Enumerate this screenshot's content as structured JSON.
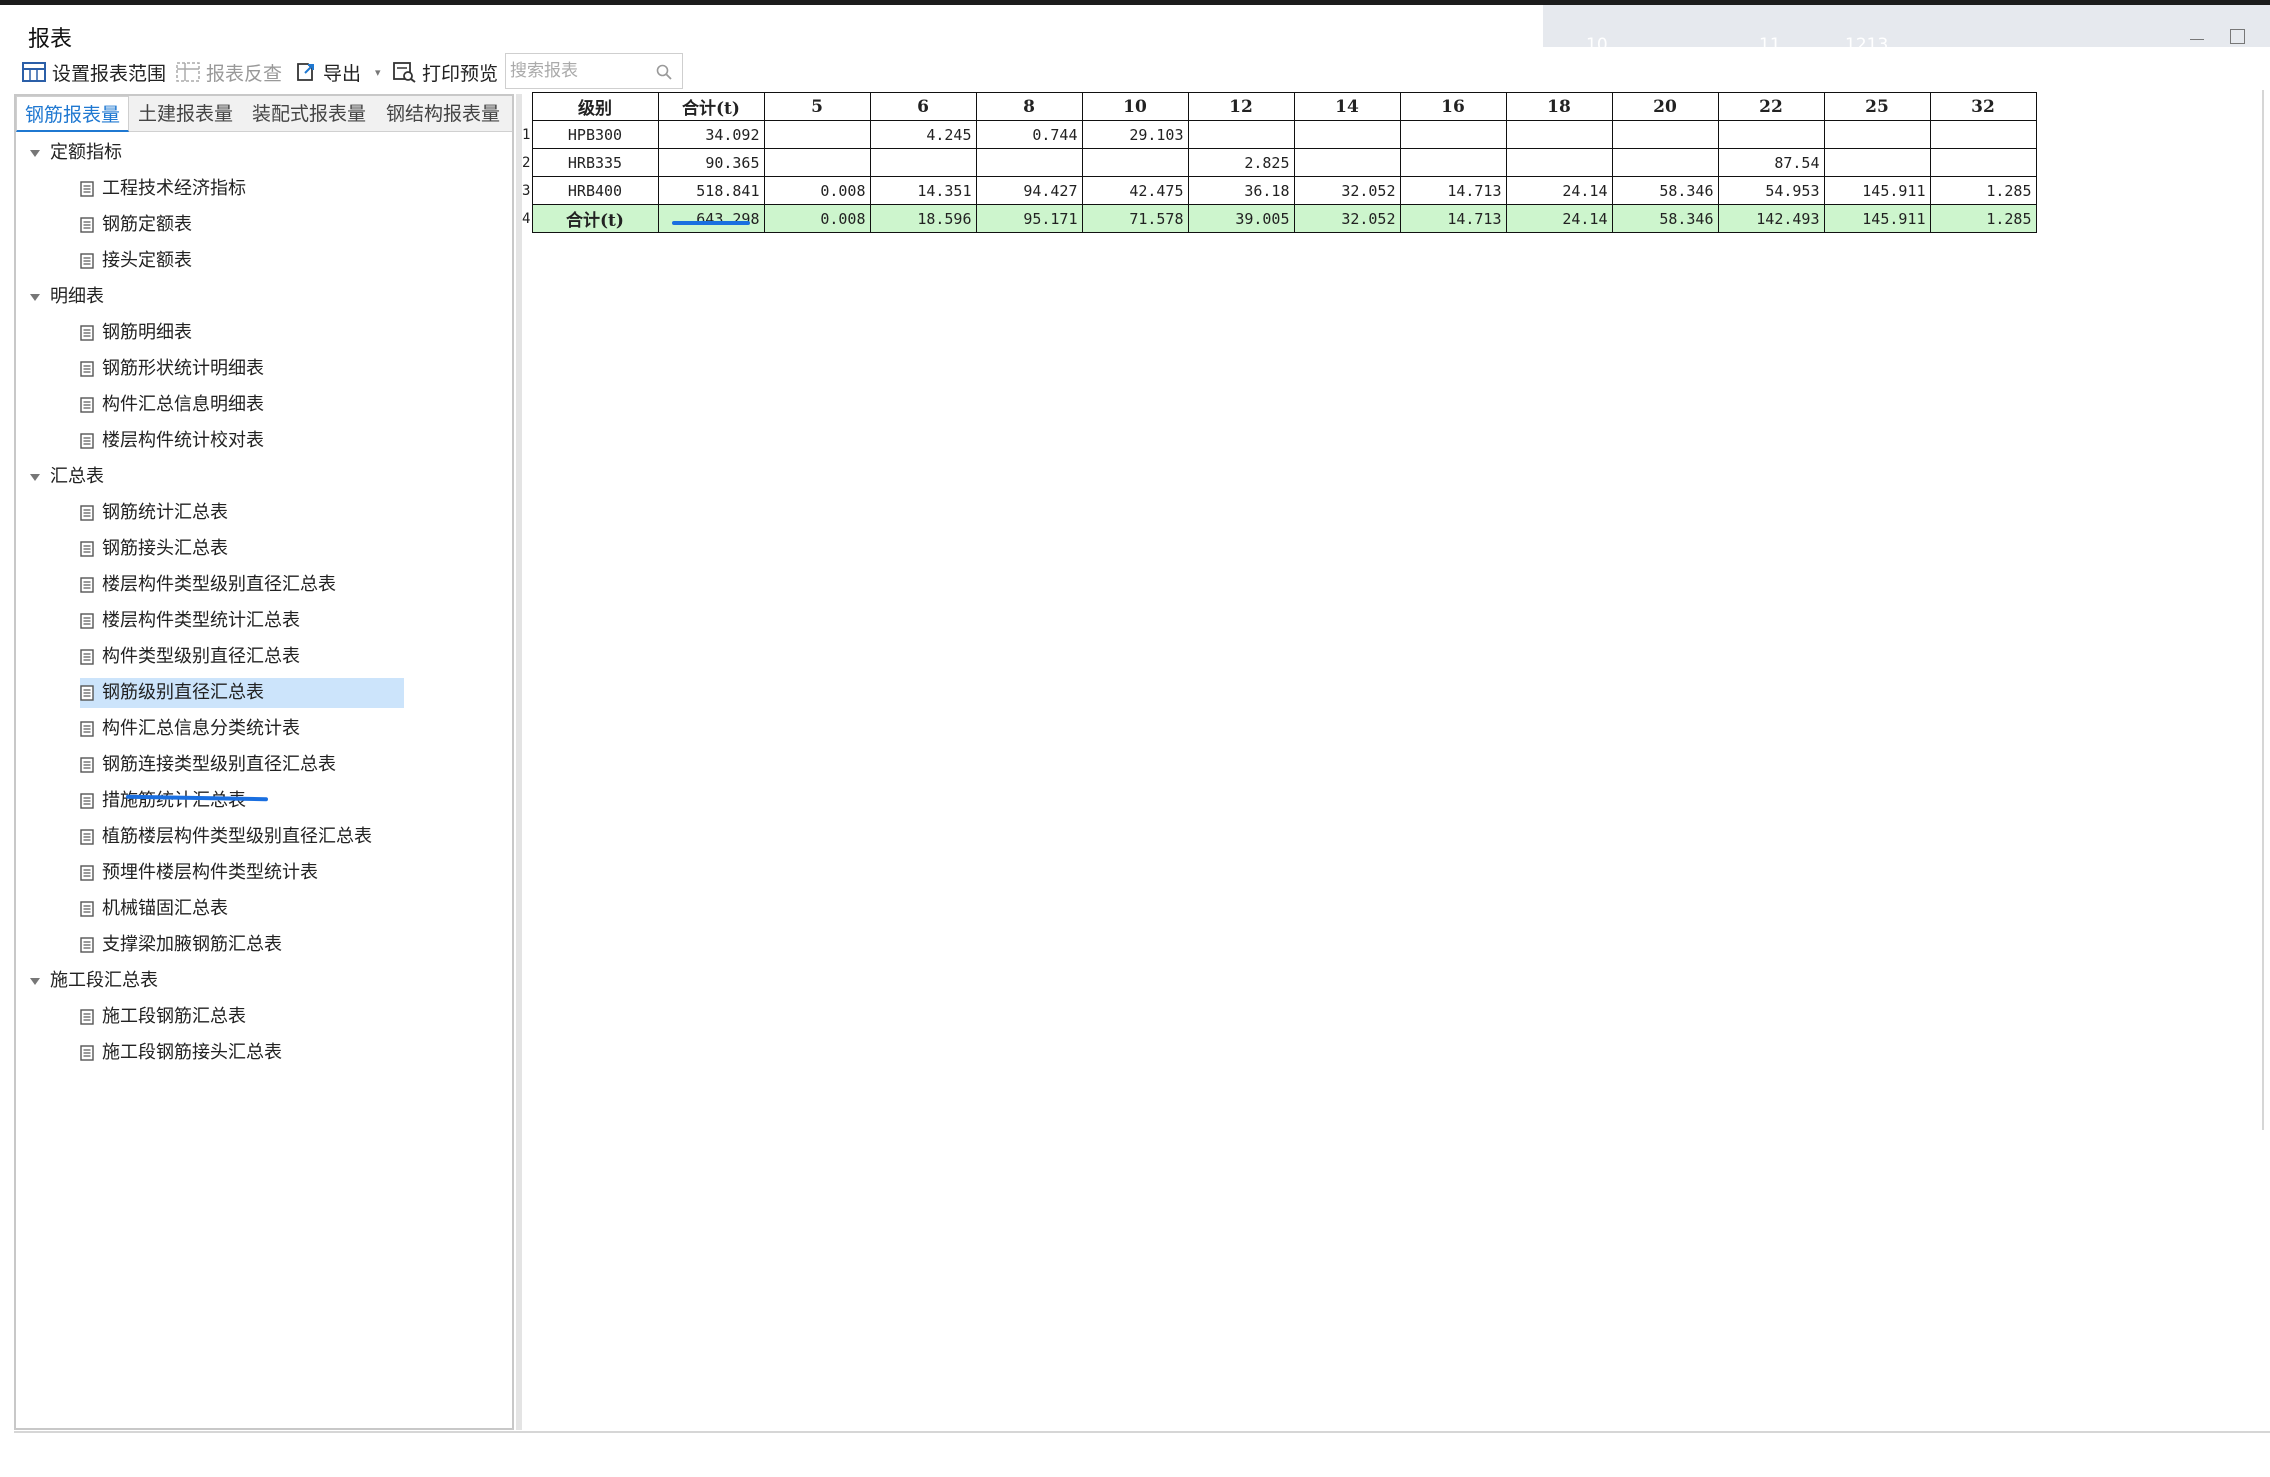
{
  "window": {
    "title": "报表"
  },
  "ghost_digits": [
    "10",
    "11",
    "1213"
  ],
  "toolbar": {
    "set_range": "设置报表范围",
    "reverse_check": "报表反查",
    "export": "导出",
    "print_preview": "打印预览",
    "search_placeholder": "搜索报表"
  },
  "tabs": [
    "钢筋报表量",
    "土建报表量",
    "装配式报表量",
    "钢结构报表量"
  ],
  "tree": {
    "groups": [
      {
        "label": "定额指标",
        "items": [
          "工程技术经济指标",
          "钢筋定额表",
          "接头定额表"
        ]
      },
      {
        "label": "明细表",
        "items": [
          "钢筋明细表",
          "钢筋形状统计明细表",
          "构件汇总信息明细表",
          "楼层构件统计校对表"
        ]
      },
      {
        "label": "汇总表",
        "items": [
          "钢筋统计汇总表",
          "钢筋接头汇总表",
          "楼层构件类型级别直径汇总表",
          "楼层构件类型统计汇总表",
          "构件类型级别直径汇总表",
          "钢筋级别直径汇总表",
          "构件汇总信息分类统计表",
          "钢筋连接类型级别直径汇总表",
          "措施筋统计汇总表",
          "植筋楼层构件类型级别直径汇总表",
          "预埋件楼层构件类型统计表",
          "机械锚固汇总表",
          "支撑梁加腋钢筋汇总表"
        ]
      },
      {
        "label": "施工段汇总表",
        "items": [
          "施工段钢筋汇总表",
          "施工段钢筋接头汇总表"
        ]
      }
    ],
    "selected": "钢筋级别直径汇总表"
  },
  "report": {
    "headers": [
      "级别",
      "合计(t)",
      "5",
      "6",
      "8",
      "10",
      "12",
      "14",
      "16",
      "18",
      "20",
      "22",
      "25",
      "32"
    ],
    "rows": [
      {
        "n": "1",
        "cells": [
          "HPB300",
          "34.092",
          "",
          "4.245",
          "0.744",
          "29.103",
          "",
          "",
          "",
          "",
          "",
          "",
          "",
          ""
        ]
      },
      {
        "n": "2",
        "cells": [
          "HRB335",
          "90.365",
          "",
          "",
          "",
          "",
          "2.825",
          "",
          "",
          "",
          "",
          "87.54",
          "",
          ""
        ]
      },
      {
        "n": "3",
        "cells": [
          "HRB400",
          "518.841",
          "0.008",
          "14.351",
          "94.427",
          "42.475",
          "36.18",
          "32.052",
          "14.713",
          "24.14",
          "58.346",
          "54.953",
          "145.911",
          "1.285"
        ]
      },
      {
        "n": "4",
        "cells": [
          "合计(t)",
          "643.298",
          "0.008",
          "18.596",
          "95.171",
          "71.578",
          "39.005",
          "32.052",
          "14.713",
          "24.14",
          "58.346",
          "142.493",
          "145.911",
          "1.285"
        ]
      }
    ]
  },
  "colors": {
    "accent": "#1f78d1",
    "selected_bg": "#cce4fb",
    "total_row_bg": "#cdf5cd",
    "annotation": "#1a6fe0"
  }
}
